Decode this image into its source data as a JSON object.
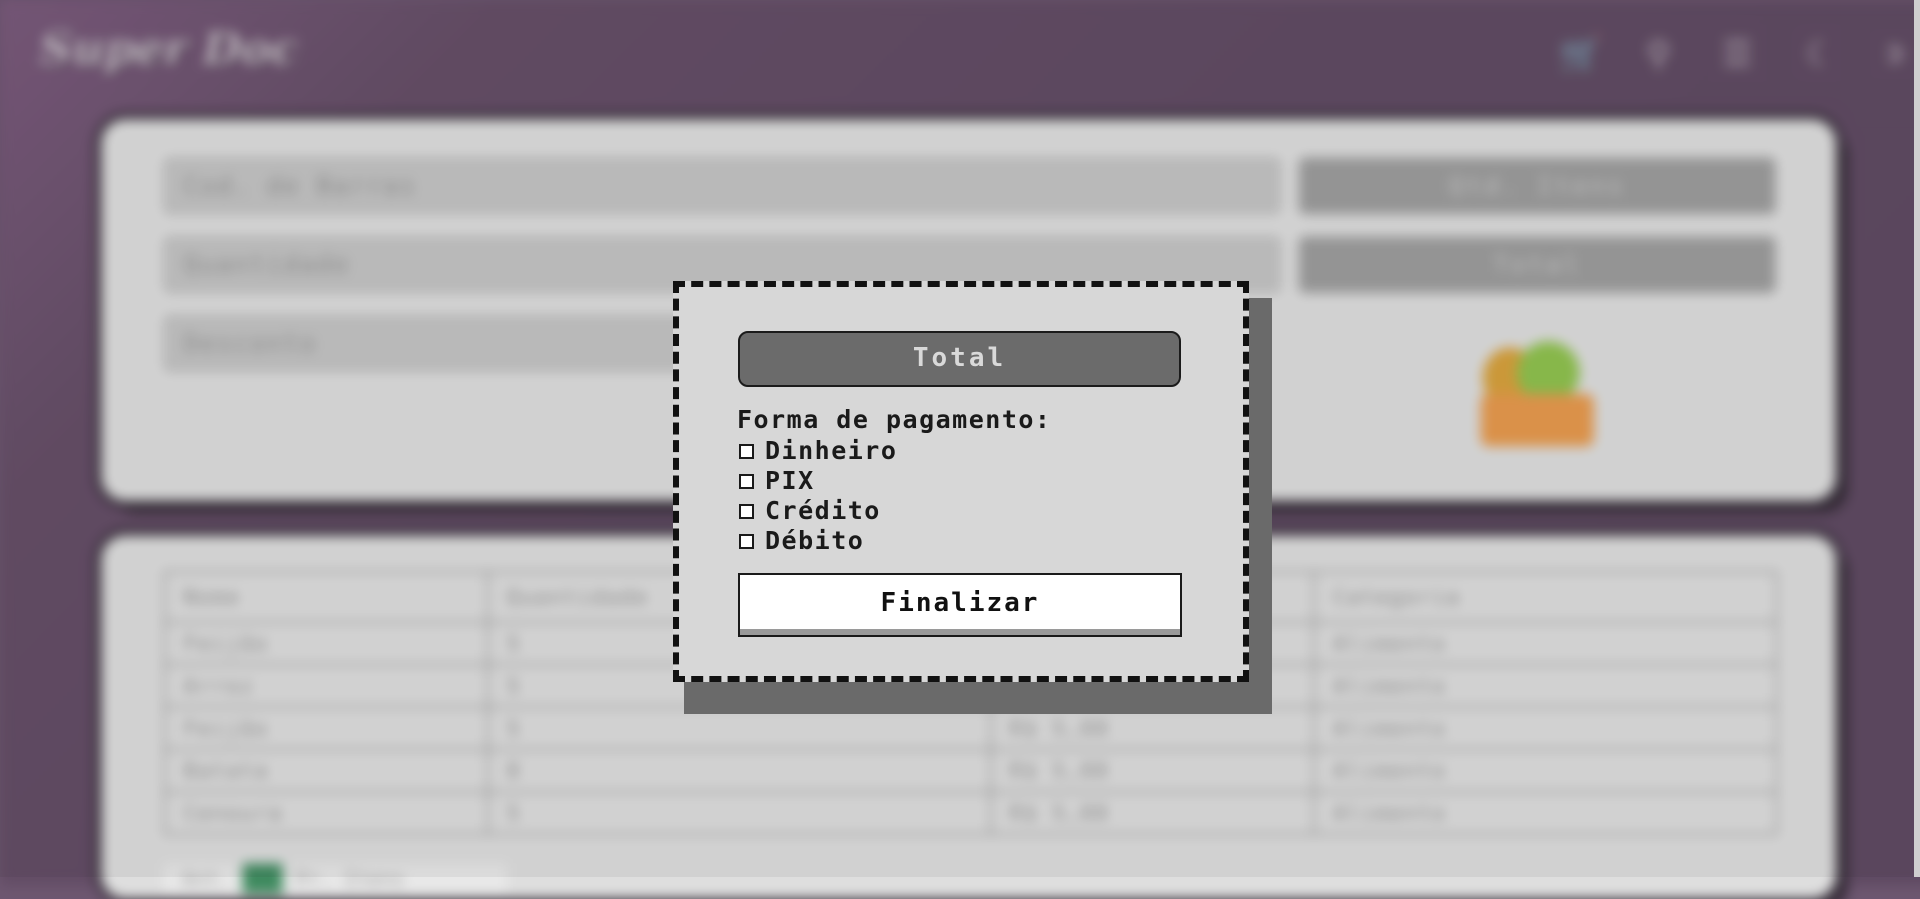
{
  "app": {
    "logo": "Super Doc"
  },
  "nav_icons": [
    "cart-icon",
    "search-icon",
    "list-icon",
    "moon-icon",
    "logout-icon"
  ],
  "background": {
    "fields": {
      "barcode": "Cod. de Barras",
      "quantity": "Quantidade",
      "discount": "Desconto"
    },
    "buttons": {
      "items_count": "Qtd. Itens",
      "total": "Total"
    },
    "table": {
      "headers": [
        "Nome",
        "Quantidade",
        "",
        "Categoria"
      ],
      "rows": [
        [
          "Feijão",
          "5",
          "",
          "Alimento"
        ],
        [
          "Arroz",
          "5",
          "",
          "Alimento"
        ],
        [
          "Feijão",
          "5",
          "R$ 5,00",
          "Alimento"
        ],
        [
          "Batata",
          "8",
          "R$ 5,00",
          "Alimento"
        ],
        [
          "Cenoura",
          "5",
          "R$ 5,00",
          "Alimento"
        ]
      ]
    },
    "pager": {
      "prev": "Ant.",
      "next": "Pr. Itens"
    }
  },
  "modal": {
    "total_label": "Total",
    "payment_heading": "Forma de pagamento:",
    "payment_options": [
      "Dinheiro",
      "PIX",
      "Crédito",
      "Débito"
    ],
    "finalize_label": "Finalizar"
  },
  "colors": {
    "background": "#604b63",
    "card": "#dedede",
    "modal_bg": "#d7d7d7",
    "total_button": "#6b6b6b",
    "accent_green": "#3f8a5f"
  }
}
